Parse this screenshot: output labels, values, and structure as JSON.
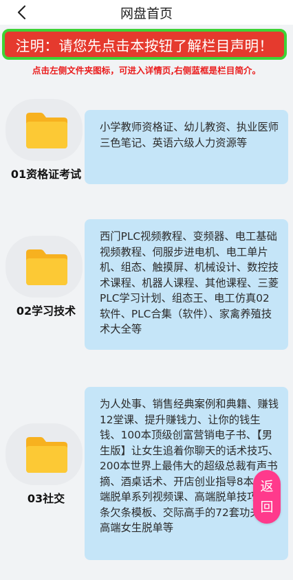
{
  "header": {
    "title": "网盘首页",
    "back_icon": "back-chevron-icon"
  },
  "notice_button": {
    "label": "注明：请您先点击本按钮了解栏目声明！",
    "colors": {
      "background": "#e53a2e",
      "border": "#3ed336",
      "text": "#ffffff"
    }
  },
  "hint": {
    "text": "点击左侧文件夹图标，可进入详情页,右侧蓝框是栏目简介。",
    "color": "#ea1c1c"
  },
  "sections": [
    {
      "icon": "folder-icon",
      "label": "01资格证考试",
      "description": "小学教师资格证、幼儿教资、执业医师三色笔记、英语六级人力资源等"
    },
    {
      "icon": "folder-icon",
      "label": "02学习技术",
      "description": "西门PLC视频教程、变频器、电工基础视频教程、伺服步进电机、电工单片机、组态、触摸屏、机械设计、数控技术课程、机器人课程、其他课程、三菱PLC学习计划、组态王、电工仿真02软件、PLC合集（软件）、家禽养殖技术大全等"
    },
    {
      "icon": "folder-icon",
      "label": "03社交",
      "description": "为人处事、销售经典案例和典籍、赚钱12堂课、提升赚钱力、让你的钱生钱、100本顶级创富营销电子书、【男生版】让女生追着你聊天的话术技巧、200本世界上最伟大的超级总裁有声书摘、酒桌话术、开店创业指导8本、高端脱单系列视频课、高端脱单技巧、借条欠条模板、交际高手的72套功夫、高端女生脱单等"
    }
  ],
  "float_button": {
    "line1": "返",
    "line2": "回",
    "color": "#ff3a8c"
  },
  "theme": {
    "page_bg": "#f1f3f5",
    "card_bg": "#c5e5f8",
    "folder_color": "#fbc52c"
  }
}
